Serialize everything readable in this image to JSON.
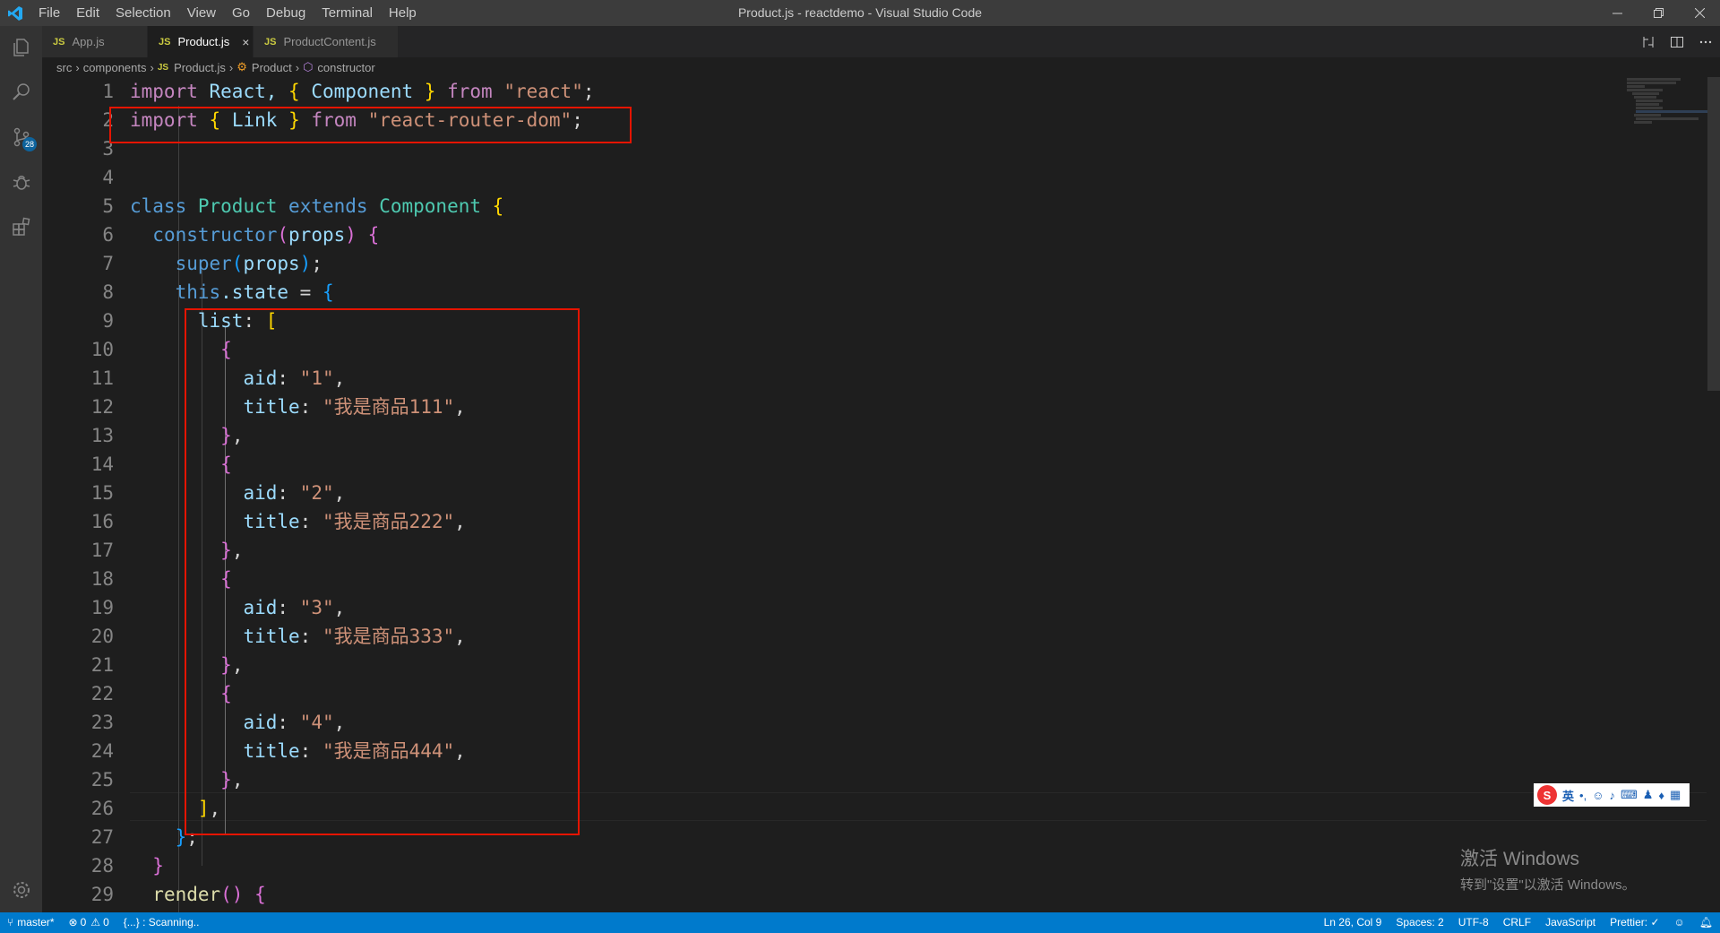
{
  "window": {
    "title": "Product.js - reactdemo - Visual Studio Code",
    "menu": [
      "File",
      "Edit",
      "Selection",
      "View",
      "Go",
      "Debug",
      "Terminal",
      "Help"
    ]
  },
  "activity_bar": {
    "scm_badge": "28"
  },
  "tabs": [
    {
      "icon": "JS",
      "label": "App.js",
      "active": false
    },
    {
      "icon": "JS",
      "label": "Product.js",
      "active": true,
      "close": "×"
    },
    {
      "icon": "JS",
      "label": "ProductContent.js",
      "active": false
    }
  ],
  "breadcrumb": {
    "items": [
      "src",
      "components",
      "Product.js",
      "Product",
      "constructor"
    ],
    "js_icon": "JS"
  },
  "editor": {
    "line_numbers": [
      "1",
      "2",
      "3",
      "4",
      "5",
      "6",
      "7",
      "8",
      "9",
      "10",
      "11",
      "12",
      "13",
      "14",
      "15",
      "16",
      "17",
      "18",
      "19",
      "20",
      "21",
      "22",
      "23",
      "24",
      "25",
      "26",
      "27",
      "28",
      "29"
    ]
  },
  "code_tokens": {
    "import": "import",
    "from": "from",
    "React": "React,",
    "Component": "Component",
    "react": "\"react\"",
    "Link": "Link",
    "router": "\"react-router-dom\"",
    "class": "class",
    "Product": "Product",
    "extends": "extends",
    "constructor": "constructor",
    "props": "props",
    "super": "super",
    "this": "this",
    "state": ".state",
    "list": "list",
    "aid": "aid",
    "title": "title",
    "aid1": "\"1\"",
    "title1": "\"我是商品111\"",
    "aid2": "\"2\"",
    "title2": "\"我是商品222\"",
    "aid3": "\"3\"",
    "title3": "\"我是商品333\"",
    "aid4": "\"4\"",
    "title4": "\"我是商品444\"",
    "render": "render"
  },
  "status_bar": {
    "branch": "master*",
    "errors": "0",
    "warnings": "0",
    "scanning": "{...} : Scanning..",
    "position": "Ln 26, Col 9",
    "spaces": "Spaces: 2",
    "encoding": "UTF-8",
    "eol": "CRLF",
    "language": "JavaScript",
    "prettier": "Prettier: ✓"
  },
  "watermark": {
    "line1": "激活 Windows",
    "line2": "转到\"设置\"以激活 Windows。"
  },
  "ime": {
    "mode": "英"
  },
  "colors": {
    "accent": "#007acc",
    "highlight_box": "#e51400"
  }
}
